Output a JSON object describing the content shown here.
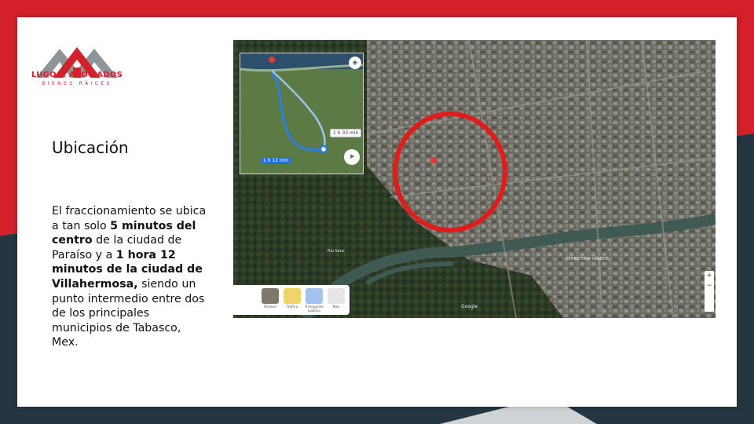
{
  "company": {
    "name": "LUGO & ASOCIADOS",
    "tagline": "BIENES RAICES"
  },
  "slide": {
    "title": "Ubicación",
    "body": {
      "p1": "El fraccionamiento se ubica a tan solo ",
      "b1": "5 minutos del centro",
      "p2": " de la ciudad de Paraíso y a ",
      "b2": "1 hora 12 minutos de la ciudad de Villahermosa,",
      "p3": " siendo un punto intermedio entre dos de los principales municipios de Tabasco, Mex."
    }
  },
  "map": {
    "route_alt_time": "1 h 33 min",
    "route_main_time": "1 h 12 min",
    "layers": [
      "Relieve",
      "Tráfico",
      "Transporte público",
      "Más"
    ],
    "labels": {
      "river": "Río Seco",
      "store": "FERRETERIA GRANDE",
      "google": "Google"
    }
  },
  "colors": {
    "brand_red": "#d3202a",
    "dark_teal": "#253640",
    "route_blue": "#4a9cf0",
    "highlight_circle": "#e21b1b"
  }
}
